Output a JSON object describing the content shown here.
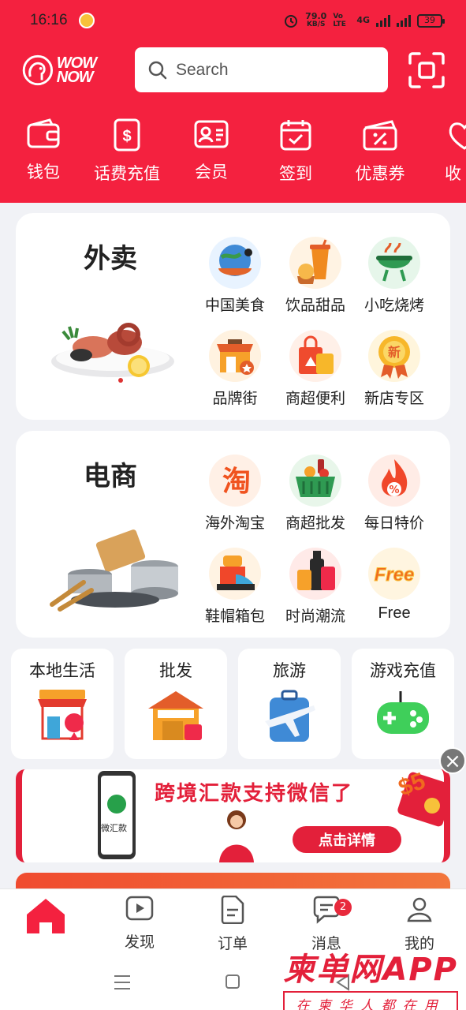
{
  "status_bar": {
    "time": "16:16",
    "net_speed": "79.0",
    "net_unit": "KB/S",
    "volte": "Vo LTE",
    "network": "4G",
    "battery": "39"
  },
  "header": {
    "logo_text": "WOW NOW",
    "search_placeholder": "Search"
  },
  "quick_actions": [
    {
      "label": "钱包",
      "icon": "wallet-icon"
    },
    {
      "label": "话费充值",
      "icon": "phone-topup-icon"
    },
    {
      "label": "会员",
      "icon": "member-card-icon"
    },
    {
      "label": "签到",
      "icon": "calendar-checkin-icon"
    },
    {
      "label": "优惠券",
      "icon": "coupon-icon"
    },
    {
      "label": "收",
      "icon": "heart-favorite-icon"
    }
  ],
  "food_card": {
    "title": "外卖",
    "categories": [
      {
        "label": "中国美食"
      },
      {
        "label": "饮品甜品"
      },
      {
        "label": "小吃烧烤"
      },
      {
        "label": "品牌街"
      },
      {
        "label": "商超便利"
      },
      {
        "label": "新店专区"
      }
    ]
  },
  "ecom_card": {
    "title": "电商",
    "categories": [
      {
        "label": "海外淘宝"
      },
      {
        "label": "商超批发"
      },
      {
        "label": "每日特价"
      },
      {
        "label": "鞋帽箱包"
      },
      {
        "label": "时尚潮流"
      },
      {
        "label": "Free"
      }
    ]
  },
  "mini_cards": [
    {
      "label": "本地生活"
    },
    {
      "label": "批发"
    },
    {
      "label": "旅游"
    },
    {
      "label": "游戏充值"
    }
  ],
  "banner": {
    "text": "跨境汇款支持微信了",
    "button": "点击详情",
    "app_label": "微汇款"
  },
  "bottom_nav": [
    {
      "label": "",
      "icon": "home-icon"
    },
    {
      "label": "发现",
      "icon": "play-icon"
    },
    {
      "label": "订单",
      "icon": "order-icon"
    },
    {
      "label": "消息",
      "icon": "message-icon",
      "badge": "2"
    },
    {
      "label": "我的",
      "icon": "profile-icon"
    }
  ],
  "watermark": {
    "big": "柬单网APP",
    "small": "在柬华人都在用"
  },
  "colors": {
    "brand_red": "#f4213f",
    "background": "#f1f2f6"
  }
}
